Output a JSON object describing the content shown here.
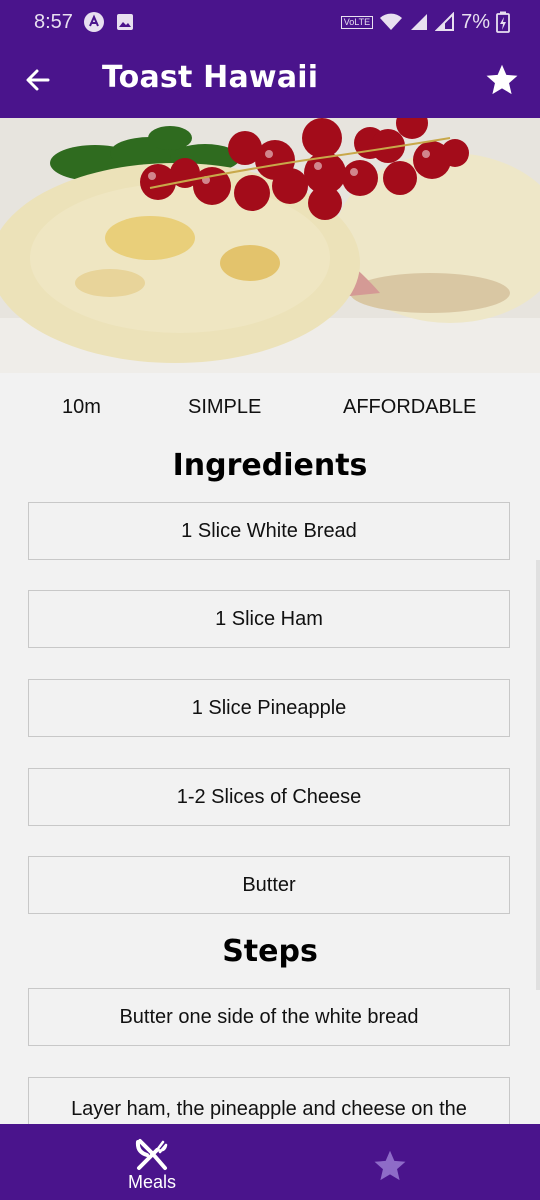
{
  "status_bar": {
    "time": "8:57",
    "battery": "7%",
    "volte_label": "VoLTE",
    "icons": [
      "app-a-icon",
      "image-icon",
      "wifi-icon",
      "signal-icon",
      "signal-icon",
      "battery-charging-icon"
    ]
  },
  "app_bar": {
    "title": "Toast Hawaii",
    "back_icon": "arrow-back-icon",
    "favorite_icon": "star-icon"
  },
  "hero_image": {
    "description_icon": "food-photo"
  },
  "meal_meta": {
    "duration": "10m",
    "complexity": "SIMPLE",
    "affordability": "AFFORDABLE"
  },
  "ingredients": {
    "title": "Ingredients",
    "items": [
      "1 Slice White Bread",
      "1 Slice Ham",
      "1 Slice Pineapple",
      "1-2 Slices of Cheese",
      "Butter"
    ]
  },
  "steps": {
    "title": "Steps",
    "items": [
      "Butter one side of the white bread",
      "Layer ham, the pineapple and cheese on the"
    ]
  },
  "bottom_nav": {
    "meals_label": "Meals",
    "meals_icon": "utensils-icon",
    "favorites_icon": "star-icon"
  },
  "colors": {
    "primary": "#4a148c",
    "background": "#f2f2f2",
    "inactive_tab": "#8e6cc8"
  }
}
